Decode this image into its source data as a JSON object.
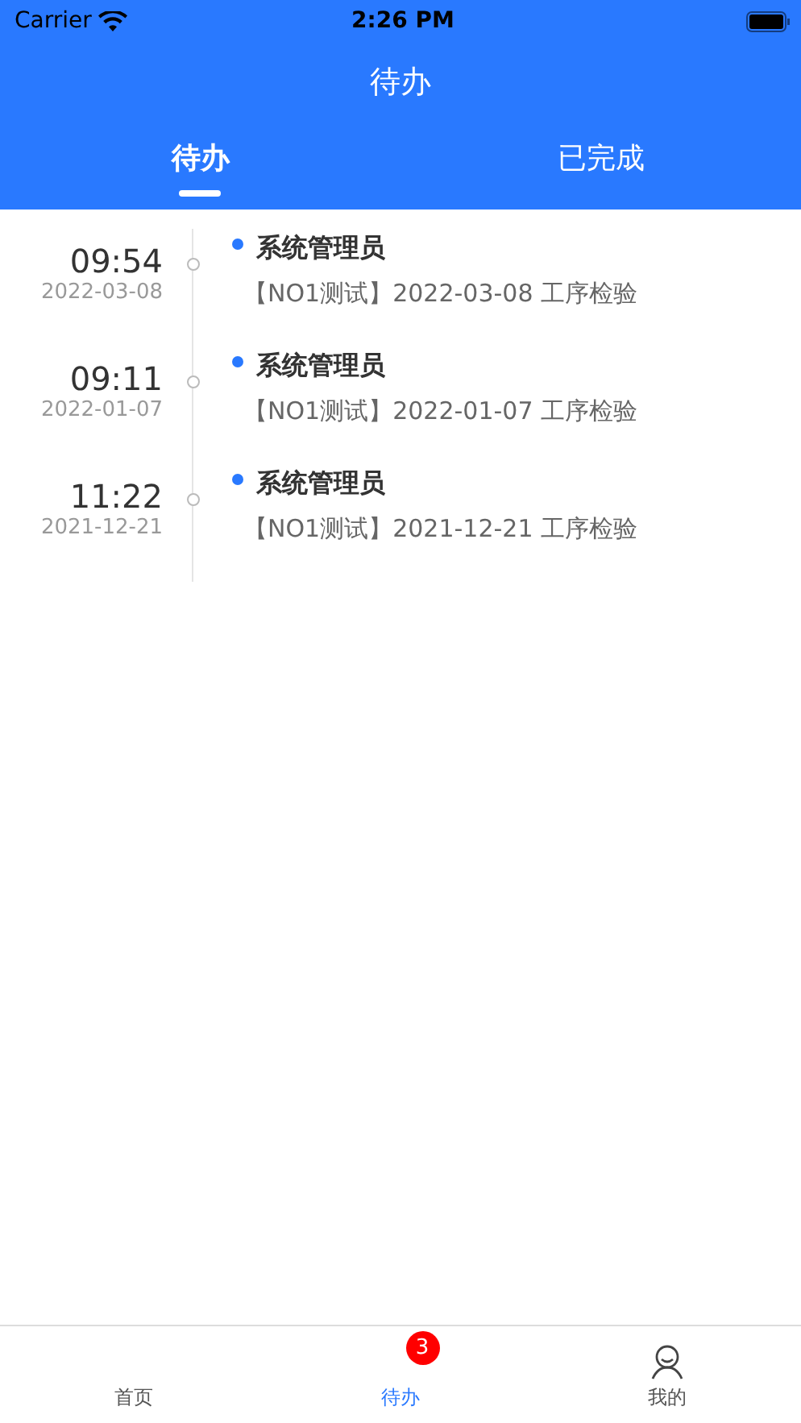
{
  "status_bar": {
    "carrier": "Carrier",
    "time": "2:26 PM"
  },
  "title": "待办",
  "tabs": [
    {
      "label": "待办",
      "selected": true
    },
    {
      "label": "已完成",
      "selected": false
    }
  ],
  "items": [
    {
      "time": "09:54",
      "date": "2022-03-08",
      "author": "系统管理员",
      "text": "【NO1测试】2022-03-08 工序检验"
    },
    {
      "time": "09:11",
      "date": "2022-01-07",
      "author": "系统管理员",
      "text": "【NO1测试】2022-01-07 工序检验"
    },
    {
      "time": "11:22",
      "date": "2021-12-21",
      "author": "系统管理员",
      "text": "【NO1测试】2021-12-21 工序检验"
    }
  ],
  "tab_bar": [
    {
      "label": "首页",
      "selected": false,
      "kind": "plain"
    },
    {
      "label": "待办",
      "selected": true,
      "kind": "badge",
      "badge": "3"
    },
    {
      "label": "我的",
      "selected": false,
      "kind": "person"
    }
  ]
}
